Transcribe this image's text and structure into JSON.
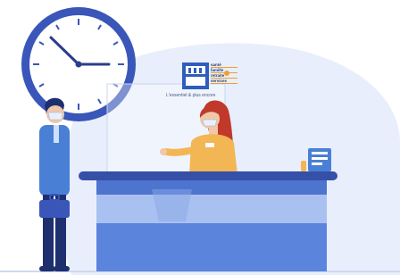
{
  "logo": {
    "monogram": "msa",
    "lines": [
      "santé",
      "famille",
      "retraite",
      "services"
    ],
    "slogan": "L'essentiel & plus encore"
  },
  "colors": {
    "background_blob": "#e8eefb",
    "clock_rim": "#3a56b8",
    "desk_top": "#3650a8",
    "desk_front": "#5b84dc",
    "shirt_blue": "#4a7fd6",
    "receptionist_top": "#f2b654",
    "hair_receptionist": "#c0392b",
    "logo_blue": "#2f5dbb"
  }
}
